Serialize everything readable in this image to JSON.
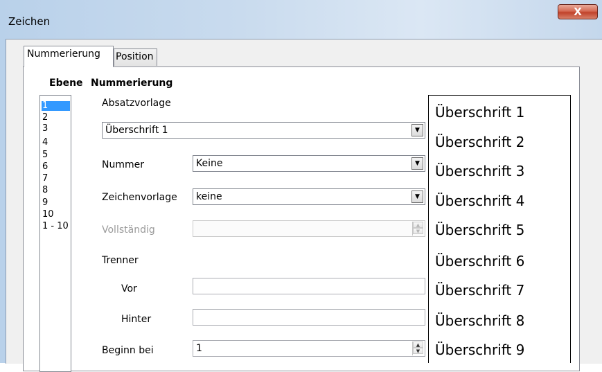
{
  "window": {
    "title": "Zeichen",
    "close_label": "X"
  },
  "tabs": [
    {
      "label": "Nummerierung",
      "active": true
    },
    {
      "label": "Position",
      "active": false
    }
  ],
  "headers": {
    "level": "Ebene",
    "numbering": "Nummerierung"
  },
  "levels": [
    "1",
    "2",
    "3",
    "4",
    "5",
    "6",
    "7",
    "8",
    "9",
    "10",
    "1 - 10"
  ],
  "selected_level": "1",
  "form": {
    "paragraph_style_label": "Absatzvorlage",
    "paragraph_style_value": "Überschrift 1",
    "number_label": "Nummer",
    "number_value": "Keine",
    "char_style_label": "Zeichenvorlage",
    "char_style_value": "keine",
    "complete_label": "Vollständig",
    "complete_value": "",
    "separator_label": "Trenner",
    "before_label": "Vor",
    "before_value": "",
    "after_label": "Hinter",
    "after_value": "",
    "start_label": "Beginn bei",
    "start_value": "1"
  },
  "preview": [
    "Überschrift 1",
    "Überschrift 2",
    "Überschrift 3",
    "Überschrift 4",
    "Überschrift 5",
    "Überschrift 6",
    "Überschrift 7",
    "Überschrift 8",
    "Überschrift 9"
  ]
}
